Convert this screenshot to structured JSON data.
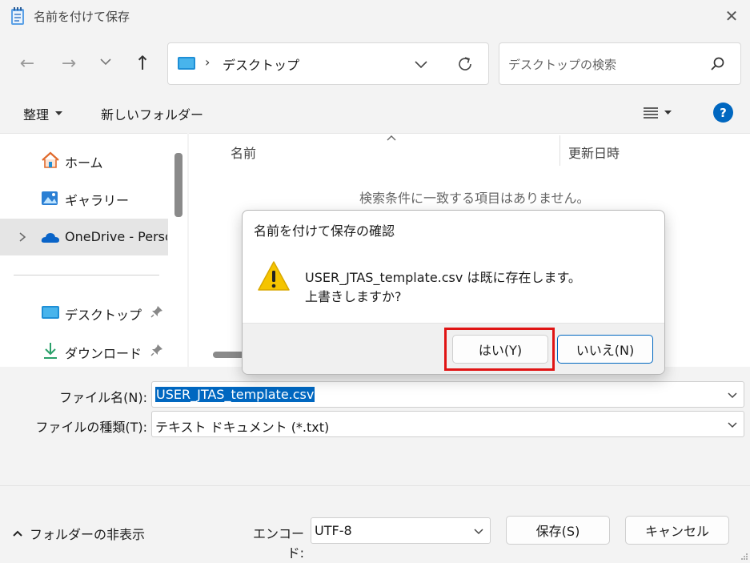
{
  "window": {
    "title": "名前を付けて保存",
    "close_glyph": "✕"
  },
  "nav": {
    "back_glyph": "←",
    "forward_glyph": "→",
    "recent_glyph": "⌄",
    "up_glyph": "↑"
  },
  "address": {
    "separator": "›",
    "path": "デスクトップ"
  },
  "search": {
    "placeholder": "デスクトップの検索"
  },
  "toolbar": {
    "organize_label": "整理",
    "new_folder_label": "新しいフォルダー",
    "help_label": "?"
  },
  "sidebar": {
    "items": [
      {
        "label": "ホーム",
        "icon": "home-icon"
      },
      {
        "label": "ギャラリー",
        "icon": "gallery-icon"
      },
      {
        "label": "OneDrive - Perso",
        "icon": "onedrive-icon"
      },
      {
        "label": "デスクトップ",
        "icon": "desktop-folder-icon",
        "pinned": true
      },
      {
        "label": "ダウンロード",
        "icon": "download-icon",
        "pinned": true
      }
    ]
  },
  "filelist": {
    "columns": [
      "名前",
      "更新日時"
    ],
    "empty_message": "検索条件に一致する項目はありません。"
  },
  "form": {
    "filename_label": "ファイル名(N):",
    "filename_value": "USER_JTAS_template.csv",
    "filetype_label": "ファイルの種類(T):",
    "filetype_value": "テキスト ドキュメント (*.txt)",
    "encoding_label": "エンコード:",
    "encoding_value": "UTF-8",
    "save_label": "保存(S)",
    "cancel_label": "キャンセル",
    "hide_folders_label": "フォルダーの非表示"
  },
  "dialog": {
    "title": "名前を付けて保存の確認",
    "message_line1": "USER_JTAS_template.csv は既に存在します。",
    "message_line2": "上書きしますか?",
    "yes_label": "はい(Y)",
    "no_label": "いいえ(N)"
  },
  "colors": {
    "accent": "#0067c0",
    "highlight_border": "#e01414",
    "warning": "#f5c400"
  }
}
